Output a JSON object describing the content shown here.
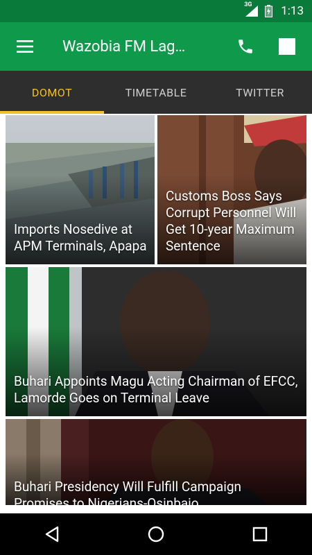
{
  "status_bar": {
    "network": "3G",
    "time": "1:13"
  },
  "app_bar": {
    "title": "Wazobia FM Lag…",
    "menu_icon": "hamburger-menu-icon",
    "call_icon": "phone-icon",
    "stop_icon": "stop-icon",
    "background": "#0e9a4a"
  },
  "tabs": [
    {
      "label": "DOMOT",
      "active": true
    },
    {
      "label": "TIMETABLE",
      "active": false
    },
    {
      "label": "TWITTER",
      "active": false
    }
  ],
  "accent_color": "#f2c02f",
  "articles": [
    {
      "headline": "Imports Nosedive at APM Terminals, Apapa"
    },
    {
      "headline": "Customs Boss Says Corrupt Personnel Will Get 10-year Maximum Sentence"
    },
    {
      "headline": "Buhari Appoints Magu Acting Chairman of EFCC, Lamorde Goes on Terminal Leave"
    },
    {
      "headline": "Buhari Presidency Will Fulfill Campaign Promises to Nigerians-Osinbajo"
    }
  ],
  "nav_bar": {
    "back_icon": "back-triangle-icon",
    "home_icon": "home-circle-icon",
    "recents_icon": "recents-square-icon"
  }
}
